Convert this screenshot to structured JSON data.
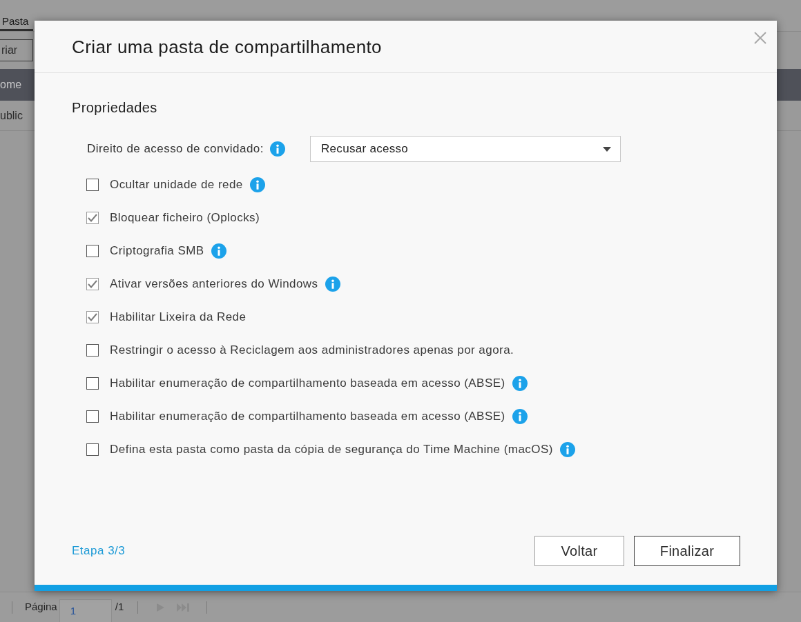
{
  "background": {
    "tabs": [
      {
        "label": "Pasta",
        "selected": true
      }
    ],
    "toolbar": {
      "button": "riar"
    },
    "table": {
      "columns": [
        "ome"
      ],
      "rows": [
        [
          "ublic"
        ]
      ]
    },
    "pagination": {
      "label": "Página",
      "page": "1",
      "total": "/1"
    }
  },
  "dialog": {
    "title": "Criar uma pasta de compartilhamento",
    "section_title": "Propriedades",
    "guest_access": {
      "label": "Direito de acesso de convidado:",
      "info": true,
      "value": "Recusar acesso"
    },
    "options": [
      {
        "label": "Ocultar unidade de rede",
        "checked": false,
        "info": true
      },
      {
        "label": "Bloquear ficheiro (Oplocks)",
        "checked": true,
        "info": false
      },
      {
        "label": "Criptografia SMB",
        "checked": false,
        "info": true
      },
      {
        "label": "Ativar versões anteriores do Windows",
        "checked": true,
        "info": true
      },
      {
        "label": "Habilitar Lixeira da Rede",
        "checked": true,
        "info": false
      },
      {
        "label": "Restringir o acesso à Reciclagem aos administradores apenas por agora.",
        "checked": false,
        "info": false
      },
      {
        "label": "Habilitar enumeração de compartilhamento baseada em acesso (ABSE)",
        "checked": false,
        "info": true
      },
      {
        "label": "Habilitar enumeração de compartilhamento baseada em acesso (ABSE)",
        "checked": false,
        "info": true
      },
      {
        "label": "Defina esta pasta como pasta da cópia de segurança do Time Machine (macOS)",
        "checked": false,
        "info": true
      }
    ],
    "step": "Etapa 3/3",
    "buttons": [
      {
        "label": "Voltar",
        "kind": "secondary"
      },
      {
        "label": "Finalizar",
        "kind": "primary"
      }
    ]
  }
}
